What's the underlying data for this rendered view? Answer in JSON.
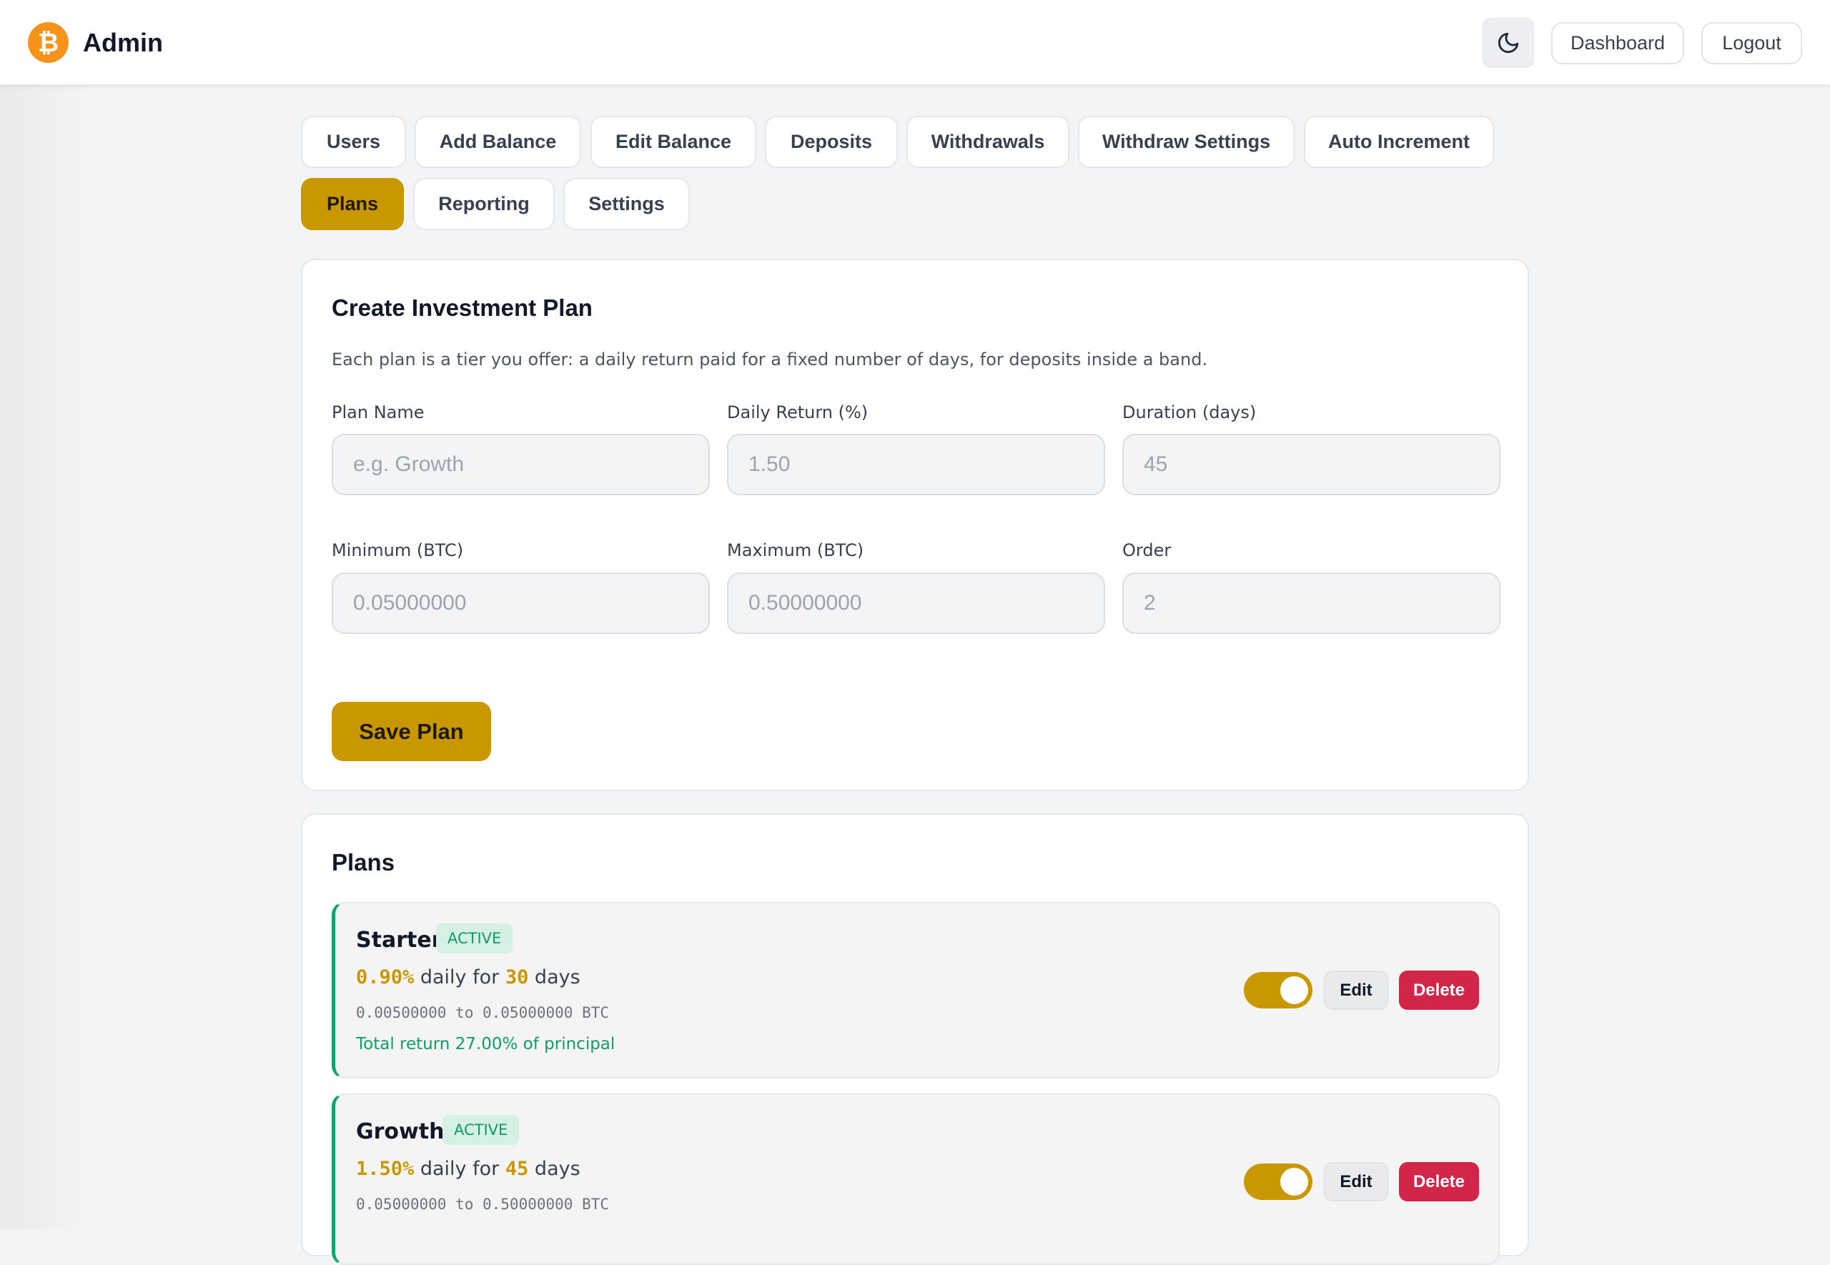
{
  "header": {
    "logo_symbol": "₿",
    "title": "Admin",
    "theme_icon": "moon-icon",
    "dashboard_label": "Dashboard",
    "logout_label": "Logout"
  },
  "tabs": [
    {
      "label": "Users",
      "active": false
    },
    {
      "label": "Add Balance",
      "active": false
    },
    {
      "label": "Edit Balance",
      "active": false
    },
    {
      "label": "Deposits",
      "active": false
    },
    {
      "label": "Withdrawals",
      "active": false
    },
    {
      "label": "Withdraw Settings",
      "active": false
    },
    {
      "label": "Auto Increment",
      "active": false
    },
    {
      "label": "Plans",
      "active": true
    },
    {
      "label": "Reporting",
      "active": false
    },
    {
      "label": "Settings",
      "active": false
    }
  ],
  "create_form": {
    "title": "Create Investment Plan",
    "description": "Each plan is a tier you offer: a daily return paid for a fixed number of days, for deposits inside a band.",
    "fields": {
      "plan_name": {
        "label": "Plan Name",
        "placeholder": "e.g. Growth",
        "value": ""
      },
      "daily_return": {
        "label": "Daily Return (%)",
        "placeholder": "1.50",
        "value": ""
      },
      "duration": {
        "label": "Duration (days)",
        "placeholder": "45",
        "value": ""
      },
      "minimum": {
        "label": "Minimum (BTC)",
        "placeholder": "0.05000000",
        "value": ""
      },
      "maximum": {
        "label": "Maximum (BTC)",
        "placeholder": "0.50000000",
        "value": ""
      },
      "order": {
        "label": "Order",
        "placeholder": "2",
        "value": ""
      }
    },
    "save_label": "Save Plan"
  },
  "plans_section": {
    "title": "Plans",
    "items": [
      {
        "name": "Starter",
        "status": "ACTIVE",
        "rate": "0.90%",
        "daily_for": " daily for ",
        "days": "30",
        "days_suffix": " days",
        "range": "0.00500000 to 0.05000000 BTC",
        "total": "Total return 27.00% of principal",
        "enabled": true,
        "edit_label": "Edit",
        "delete_label": "Delete"
      },
      {
        "name": "Growth",
        "status": "ACTIVE",
        "rate": "1.50%",
        "daily_for": " daily for ",
        "days": "45",
        "days_suffix": " days",
        "range": "0.05000000 to 0.50000000 BTC",
        "enabled": true,
        "edit_label": "Edit",
        "delete_label": "Delete"
      }
    ]
  },
  "colors": {
    "accent": "#c99700",
    "active_green": "#10a66b",
    "danger": "#d1264a",
    "bitcoin_orange": "#f7931a"
  }
}
